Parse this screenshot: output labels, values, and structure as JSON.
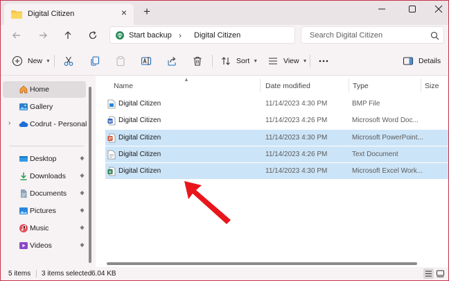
{
  "window": {
    "tab_title": "Digital Citizen"
  },
  "address": {
    "crumbs": [
      "Start backup",
      "Digital Citizen"
    ],
    "search_placeholder": "Search Digital Citizen"
  },
  "commands": {
    "new": "New",
    "sort": "Sort",
    "view": "View",
    "details": "Details"
  },
  "sidebar": {
    "items": [
      {
        "label": "Home",
        "icon": "home-icon",
        "selected": true
      },
      {
        "label": "Gallery",
        "icon": "gallery-icon"
      },
      {
        "label": "Codrut - Personal",
        "icon": "onedrive-cloud-icon"
      },
      {
        "label": "Desktop",
        "icon": "desktop-folder-icon",
        "pinned": true
      },
      {
        "label": "Downloads",
        "icon": "downloads-folder-icon",
        "pinned": true
      },
      {
        "label": "Documents",
        "icon": "documents-folder-icon",
        "pinned": true
      },
      {
        "label": "Pictures",
        "icon": "pictures-folder-icon",
        "pinned": true
      },
      {
        "label": "Music",
        "icon": "music-folder-icon",
        "pinned": true
      },
      {
        "label": "Videos",
        "icon": "videos-folder-icon",
        "pinned": true
      }
    ]
  },
  "columns": [
    "Name",
    "Date modified",
    "Type",
    "Size"
  ],
  "files": [
    {
      "name": "Digital Citizen",
      "date": "11/14/2023 4:30 PM",
      "type": "BMP File",
      "icon": "bmp-file-icon",
      "selected": false
    },
    {
      "name": "Digital Citizen",
      "date": "11/14/2023 4:26 PM",
      "type": "Microsoft Word Doc...",
      "icon": "word-file-icon",
      "selected": false
    },
    {
      "name": "Digital Citizen",
      "date": "11/14/2023 4:30 PM",
      "type": "Microsoft PowerPoint...",
      "icon": "powerpoint-file-icon",
      "selected": true
    },
    {
      "name": "Digital Citizen",
      "date": "11/14/2023 4:26 PM",
      "type": "Text Document",
      "icon": "text-file-icon",
      "selected": true
    },
    {
      "name": "Digital Citizen",
      "date": "11/14/2023 4:30 PM",
      "type": "Microsoft Excel Work...",
      "icon": "excel-file-icon",
      "selected": true
    }
  ],
  "status": {
    "count": "5 items",
    "selection": "3 items selected",
    "size": "6.04 KB"
  },
  "colors": {
    "accent": "#c4314b",
    "selection": "#cce4f7",
    "annotation_arrow": "#e8151b"
  }
}
